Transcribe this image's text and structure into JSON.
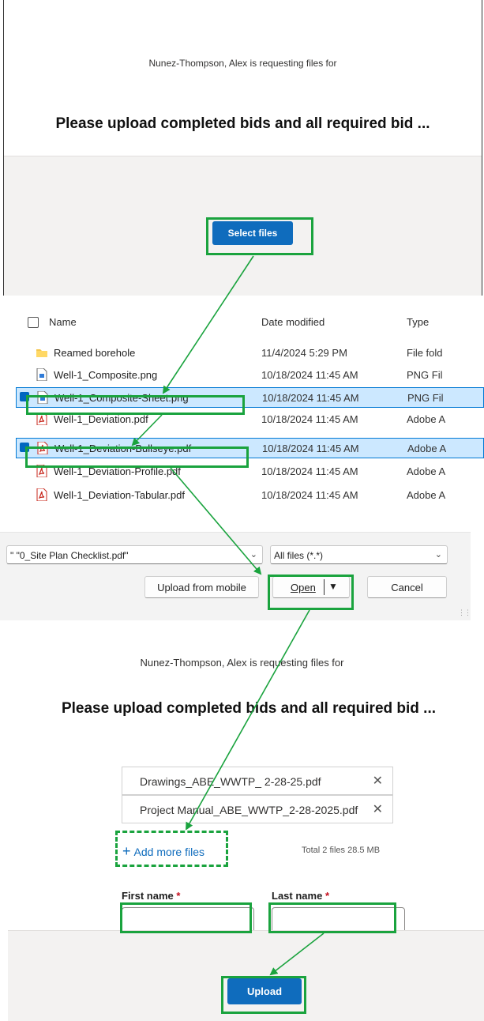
{
  "panel1": {
    "requesting_text": "Nunez-Thompson, Alex is requesting files for",
    "title": "Please upload completed bids and all required bid ...",
    "select_files_label": "Select files"
  },
  "dialog": {
    "columns": {
      "name": "Name",
      "date": "Date modified",
      "type": "Type"
    },
    "rows": [
      {
        "name": "Reamed borehole",
        "date": "11/4/2024 5:29 PM",
        "type": "File fold",
        "icon": "folder-icon",
        "selected": false
      },
      {
        "name": "Well-1_Composite.png",
        "date": "10/18/2024 11:45 AM",
        "type": "PNG Fil",
        "icon": "png-file-icon",
        "selected": false
      },
      {
        "name": "Well-1_Composite-Sheet.png",
        "date": "10/18/2024 11:45 AM",
        "type": "PNG Fil",
        "icon": "png-file-icon",
        "selected": true
      },
      {
        "name": "Well-1_Deviation.pdf",
        "date": "10/18/2024 11:45 AM",
        "type": "Adobe A",
        "icon": "pdf-file-icon",
        "selected": false
      },
      {
        "name": "Well-1_Deviation-Bullseye.pdf",
        "date": "10/18/2024 11:45 AM",
        "type": "Adobe A",
        "icon": "pdf-file-icon",
        "selected": true
      },
      {
        "name": "Well-1_Deviation-Profile.pdf",
        "date": "10/18/2024 11:45 AM",
        "type": "Adobe A",
        "icon": "pdf-file-icon",
        "selected": false
      },
      {
        "name": "Well-1_Deviation-Tabular.pdf",
        "date": "10/18/2024 11:45 AM",
        "type": "Adobe A",
        "icon": "pdf-file-icon",
        "selected": false
      }
    ],
    "filename_value": "\" \"0_Site Plan Checklist.pdf\"",
    "filter_value": "All files (*.*)",
    "upload_mobile_label": "Upload from mobile",
    "open_label": "Open",
    "cancel_label": "Cancel"
  },
  "panel3": {
    "requesting_text": "Nunez-Thompson, Alex is requesting files for",
    "title": "Please upload completed bids and all required bid ...",
    "files": [
      {
        "name": "Drawings_ABE_WWTP_ 2-28-25.pdf"
      },
      {
        "name": "Project Manual_ABE_WWTP_2-28-2025.pdf"
      }
    ],
    "add_more_label": "Add more files",
    "total_text": "Total 2 files  28.5 MB",
    "first_name_label": "First name",
    "last_name_label": "Last name",
    "required_mark": "*",
    "upload_label": "Upload"
  },
  "colors": {
    "primary": "#0f6cbd",
    "highlight": "#1aa33e",
    "selection": "#cce8ff"
  }
}
